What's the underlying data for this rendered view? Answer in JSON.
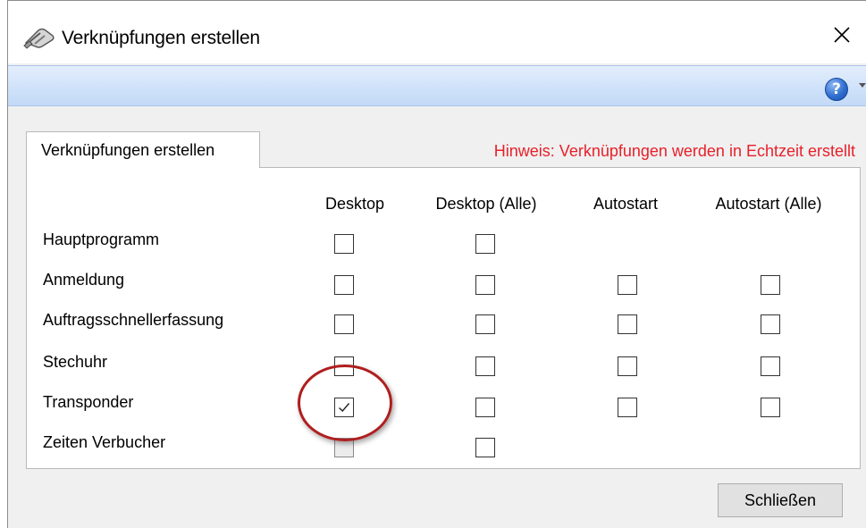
{
  "window": {
    "title": "Verknüpfungen erstellen"
  },
  "tab": {
    "label": "Verknüpfungen erstellen"
  },
  "hint": "Hinweis: Verknüpfungen werden in Echtzeit erstellt",
  "columns": [
    "Desktop",
    "Desktop (Alle)",
    "Autostart",
    "Autostart (Alle)"
  ],
  "rows": [
    {
      "label": "Hauptprogramm",
      "checks": [
        "unchecked",
        "unchecked",
        null,
        null
      ]
    },
    {
      "label": "Anmeldung",
      "checks": [
        "unchecked",
        "unchecked",
        "unchecked",
        "unchecked"
      ]
    },
    {
      "label": "Auftragsschnellerfassung",
      "checks": [
        "unchecked",
        "unchecked",
        "unchecked",
        "unchecked"
      ]
    },
    {
      "label": "Stechuhr",
      "checks": [
        "unchecked",
        "unchecked",
        "unchecked",
        "unchecked"
      ]
    },
    {
      "label": "Transponder",
      "checks": [
        "checked",
        "unchecked",
        "unchecked",
        "unchecked"
      ]
    },
    {
      "label": "Zeiten Verbucher",
      "checks": [
        "disabled",
        "unchecked",
        null,
        null
      ]
    }
  ],
  "buttons": {
    "close": "Schließen"
  },
  "icons": {
    "app": "shortcut-chain-icon",
    "close": "close-icon",
    "help": "help-icon",
    "help_dropdown": "chevron-down-icon"
  },
  "colors": {
    "hint": "#e8202a",
    "highlight": "#b01e1e",
    "ribbon": "#d0e2fa"
  }
}
